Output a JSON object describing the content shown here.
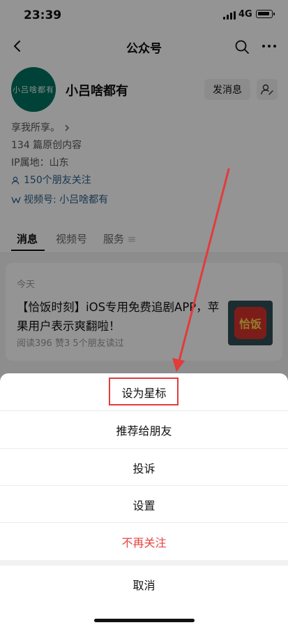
{
  "status_bar": {
    "time": "23:39",
    "network": "4G"
  },
  "nav": {
    "title": "公众号"
  },
  "profile": {
    "name": "小吕啥都有",
    "avatar_text": "小吕啥都有",
    "send_button": "发消息",
    "intro": "享我所享。",
    "original_count": "134 篇原创内容",
    "ip_location": "IP属地：山东",
    "friends_following": "150个朋友关注",
    "channel": "视频号: 小吕啥都有"
  },
  "tabs": [
    "消息",
    "视频号",
    "服务"
  ],
  "message": {
    "date": "今天",
    "title": "【恰饭时刻】iOS专用免费追剧APP，苹果用户表示爽翻啦！",
    "meta": "阅读396  赞3  5个朋友读过",
    "thumb_text": "恰饭"
  },
  "sheet": {
    "items": [
      "设为星标",
      "推荐给朋友",
      "投诉",
      "设置",
      "不再关注"
    ],
    "cancel": "取消"
  },
  "colors": {
    "danger": "#e64340",
    "annotation": "#e23b3b",
    "avatar": "#00735f"
  },
  "icons": [
    "back-icon",
    "search-icon",
    "more-icon",
    "user-settings-icon",
    "friends-icon",
    "channel-icon",
    "chevron-right-icon"
  ]
}
